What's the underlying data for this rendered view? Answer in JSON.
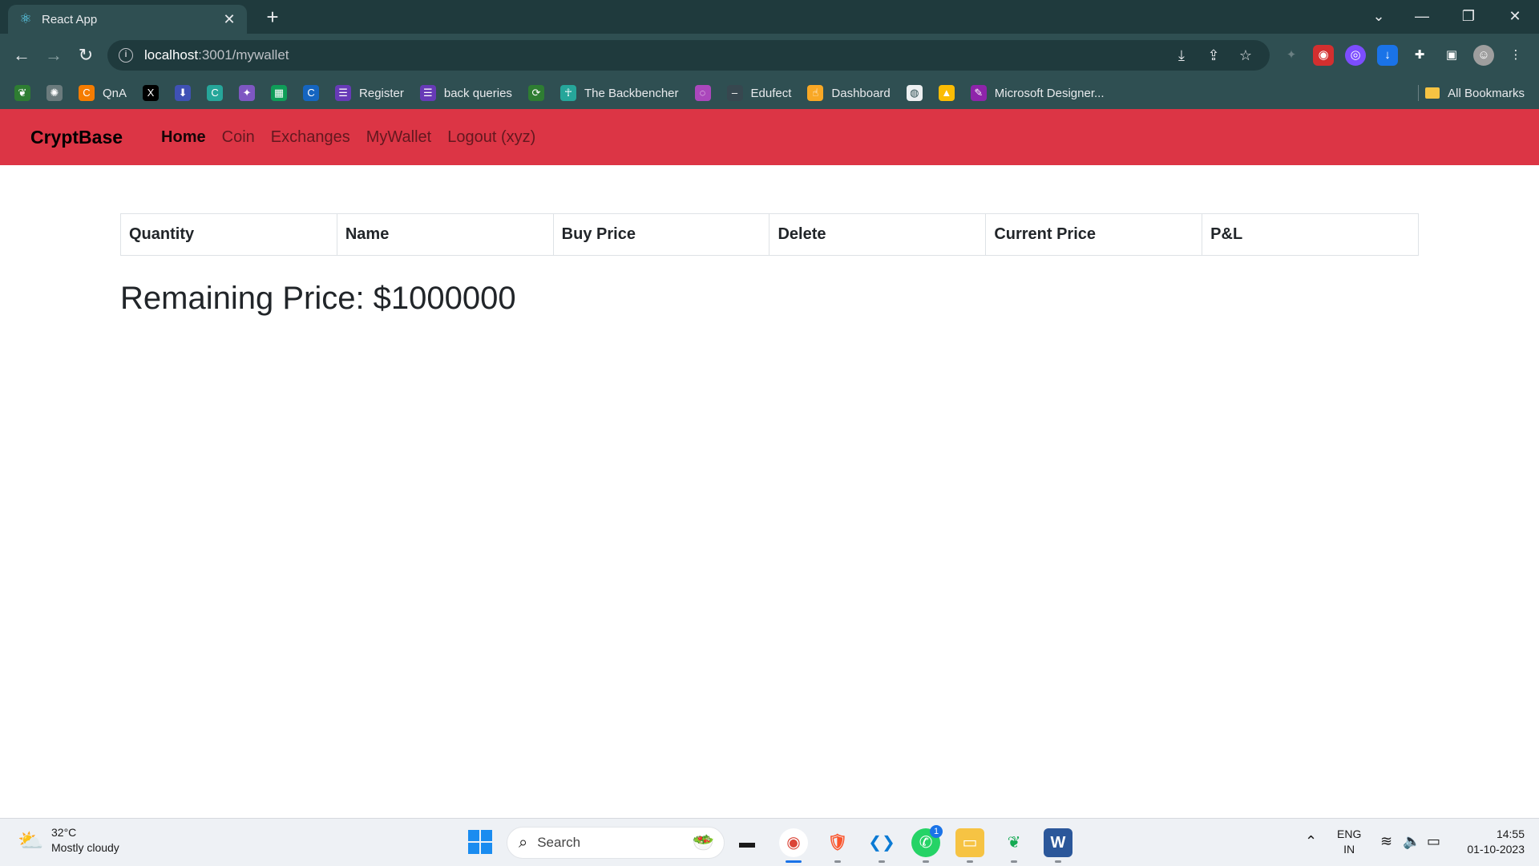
{
  "browser": {
    "tab_title": "React App",
    "url_host": "localhost",
    "url_path": ":3001/mywallet",
    "bookmarks": [
      {
        "label": "",
        "icon": "leaf-icon",
        "color": "#2e7d32"
      },
      {
        "label": "",
        "icon": "chatgpt-icon",
        "color": "#6b7b7d"
      },
      {
        "label": "QnA",
        "icon": "c-icon",
        "color": "#f57c00"
      },
      {
        "label": "",
        "icon": "x-icon",
        "color": "#000000"
      },
      {
        "label": "",
        "icon": "download-arrow-icon",
        "color": "#3f51b5"
      },
      {
        "label": "",
        "icon": "c-square-icon",
        "color": "#26a69a"
      },
      {
        "label": "",
        "icon": "sparkle-icon",
        "color": "#7e57c2"
      },
      {
        "label": "",
        "icon": "sheets-icon",
        "color": "#0f9d58"
      },
      {
        "label": "",
        "icon": "c-circle-icon",
        "color": "#1565c0"
      },
      {
        "label": "Register",
        "icon": "form-icon",
        "color": "#673ab7"
      },
      {
        "label": "back queries",
        "icon": "form-icon",
        "color": "#673ab7"
      },
      {
        "label": "",
        "icon": "sync-icon",
        "color": "#2e7d32"
      },
      {
        "label": "The Backbencher",
        "icon": "figure-icon",
        "color": "#26a69a"
      },
      {
        "label": "",
        "icon": "ring-icon",
        "color": "#ab47bc"
      },
      {
        "label": "Edufect",
        "icon": "dash-icon",
        "color": "#37474f"
      },
      {
        "label": "Dashboard",
        "icon": "hand-icon",
        "color": "#f9a825"
      },
      {
        "label": "",
        "icon": "globe-icon",
        "color": "#eceff1"
      },
      {
        "label": "",
        "icon": "drive-icon",
        "color": "#fbbc04"
      },
      {
        "label": "Microsoft Designer...",
        "icon": "designer-icon",
        "color": "#8e24aa"
      }
    ],
    "all_bookmarks": "All Bookmarks"
  },
  "navbar": {
    "brand": "CryptBase",
    "links": [
      "Home",
      "Coin",
      "Exchanges",
      "MyWallet",
      "Logout (xyz)"
    ],
    "active": "Home",
    "color": "#dc3545"
  },
  "wallet": {
    "columns": [
      "Quantity",
      "Name",
      "Buy Price",
      "Delete",
      "Current Price",
      "P&L"
    ],
    "remaining": "Remaining Price: $1000000"
  },
  "taskbar": {
    "weather_temp": "32°C",
    "weather_desc": "Mostly cloudy",
    "search_label": "Search",
    "lang_top": "ENG",
    "lang_bottom": "IN",
    "time": "14:55",
    "date": "01-10-2023",
    "whatsapp_badge": "1"
  }
}
